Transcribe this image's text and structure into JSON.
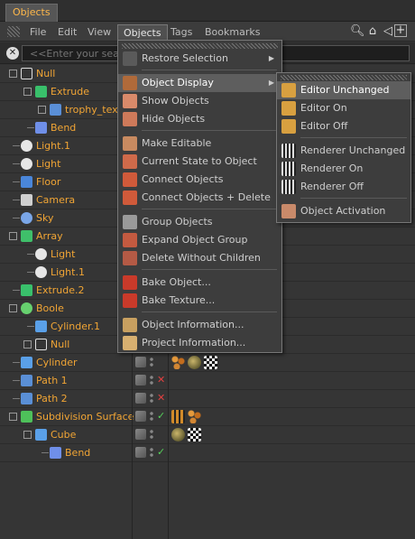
{
  "window": {
    "tab_title": "Objects"
  },
  "menubar": {
    "items": [
      "File",
      "Edit",
      "View",
      "Objects",
      "Tags",
      "Bookmarks"
    ],
    "open_item": "Objects"
  },
  "search": {
    "placeholder": "<<Enter your search here>>",
    "visible_text": "<<Enter your sear"
  },
  "objects": [
    {
      "name": "Null",
      "icon": "null-icon"
    },
    {
      "name": "Extrude",
      "icon": "extrude-icon"
    },
    {
      "name": "trophy_text_",
      "icon": "spline-icon"
    },
    {
      "name": "Bend",
      "icon": "bend-icon"
    },
    {
      "name": "Light.1",
      "icon": "light-icon"
    },
    {
      "name": "Light",
      "icon": "light-icon"
    },
    {
      "name": "Floor",
      "icon": "floor-icon"
    },
    {
      "name": "Camera",
      "icon": "camera-icon"
    },
    {
      "name": "Sky",
      "icon": "sky-icon"
    },
    {
      "name": "Array",
      "icon": "array-icon"
    },
    {
      "name": "Light",
      "icon": "light-icon"
    },
    {
      "name": "Light.1",
      "icon": "light-icon"
    },
    {
      "name": "Extrude.2",
      "icon": "extrude-icon"
    },
    {
      "name": "Boole",
      "icon": "boole-icon"
    },
    {
      "name": "Cylinder.1",
      "icon": "cylinder-icon"
    },
    {
      "name": "Null",
      "icon": "null-icon"
    },
    {
      "name": "Cylinder",
      "icon": "cylinder-icon"
    },
    {
      "name": "Path 1",
      "icon": "spline-icon"
    },
    {
      "name": "Path 2",
      "icon": "spline-icon"
    },
    {
      "name": "Subdivision Surface",
      "icon": "subdivision-icon"
    },
    {
      "name": "Cube",
      "icon": "cube-icon"
    },
    {
      "name": "Bend",
      "icon": "bend-icon"
    }
  ],
  "objects_menu": {
    "items": [
      {
        "label": "Restore Selection",
        "has_submenu": true
      },
      {
        "label": "Object Display",
        "has_submenu": true,
        "highlighted": true
      },
      {
        "label": "Show Objects"
      },
      {
        "label": "Hide Objects"
      },
      {
        "label": "Make Editable"
      },
      {
        "label": "Current State to Object"
      },
      {
        "label": "Connect Objects"
      },
      {
        "label": "Connect Objects + Delete"
      },
      {
        "label": "Group Objects"
      },
      {
        "label": "Expand Object Group"
      },
      {
        "label": "Delete Without Children"
      },
      {
        "label": "Bake Object..."
      },
      {
        "label": "Bake Texture..."
      },
      {
        "label": "Object Information..."
      },
      {
        "label": "Project Information..."
      }
    ]
  },
  "object_display_submenu": {
    "items": [
      {
        "label": "Editor Unchanged",
        "highlighted": true
      },
      {
        "label": "Editor On"
      },
      {
        "label": "Editor Off"
      },
      {
        "label": "Renderer Unchanged"
      },
      {
        "label": "Renderer On"
      },
      {
        "label": "Renderer Off"
      },
      {
        "label": "Object Activation"
      }
    ]
  },
  "colors": {
    "object_name": "#f1a535",
    "menu_bg": "#3d3d3d",
    "highlight": "#5e5e5e"
  }
}
